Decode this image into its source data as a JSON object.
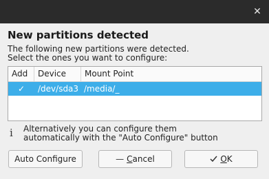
{
  "window": {
    "close_icon": "close-icon"
  },
  "dialog": {
    "heading": "New partitions detected",
    "description_line1": "The following new partitions were detected.",
    "description_line2": "Select the ones you want to configure:"
  },
  "table": {
    "columns": [
      "Add",
      "Device",
      "Mount Point"
    ],
    "rows": [
      {
        "add": "✓",
        "checked": true,
        "device": "/dev/sda3",
        "mount_point": "/media/_"
      }
    ],
    "selected_row_color": "#3daee9"
  },
  "info": {
    "icon": "info-icon",
    "line1": "Alternatively you can configure them",
    "line2": "automatically with the \"Auto Configure\" button"
  },
  "buttons": {
    "auto_configure": "Auto Configure",
    "cancel_icon": "minus-icon",
    "cancel_prefix": "",
    "cancel_accel": "C",
    "cancel_rest": "ancel",
    "ok_icon": "checkmark-icon",
    "ok_accel": "O",
    "ok_rest": "K"
  }
}
